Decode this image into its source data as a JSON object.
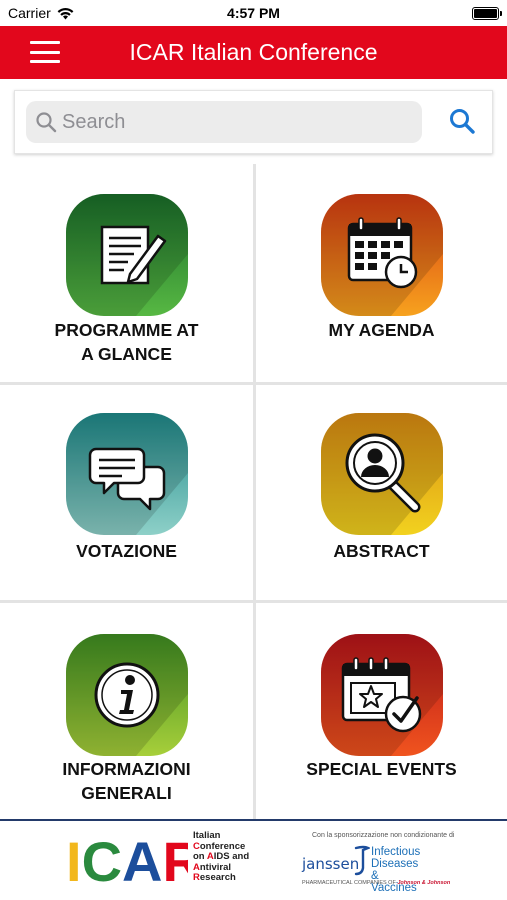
{
  "status_bar": {
    "carrier": "Carrier",
    "time": "4:57 PM"
  },
  "header": {
    "title": "ICAR Italian Conference",
    "background_color": "#e2071c"
  },
  "search": {
    "placeholder": "Search",
    "value": ""
  },
  "tiles": [
    {
      "id": "programme",
      "label_line1": "PROGRAMME AT",
      "label_line2": "A GLANCE",
      "icon": "document-pencil-icon",
      "color": "#2e8b2a"
    },
    {
      "id": "agenda",
      "label_line1": "MY AGENDA",
      "label_line2": "",
      "icon": "calendar-clock-icon",
      "color": "#e8501c"
    },
    {
      "id": "votazione",
      "label_line1": "VOTAZIONE",
      "label_line2": "",
      "icon": "chat-bubbles-icon",
      "color": "#2aa3a3"
    },
    {
      "id": "abstract",
      "label_line1": "ABSTRACT",
      "label_line2": "",
      "icon": "user-magnifier-icon",
      "color": "#e0a21b"
    },
    {
      "id": "informazioni",
      "label_line1": "INFORMAZIONI",
      "label_line2": "GENERALI",
      "icon": "info-icon",
      "color": "#5aa52a"
    },
    {
      "id": "special",
      "label_line1": "SPECIAL EVENTS",
      "label_line2": "",
      "icon": "calendar-star-check-icon",
      "color": "#d41f1f"
    }
  ],
  "footer": {
    "icar_logo": "ICAR",
    "icar_tagline": [
      "Italian",
      "Conference",
      "on AIDS and",
      "Antiviral",
      "Research"
    ],
    "sponsor_note": "Con la sponsorizzazione non condizionante di",
    "sponsor_name": "janssen",
    "sponsor_division": [
      "Infectious Diseases",
      "& Vaccines"
    ],
    "sponsor_sub_prefix": "PHARMACEUTICAL COMPANIES OF",
    "sponsor_sub_brand": "Johnson & Johnson"
  }
}
